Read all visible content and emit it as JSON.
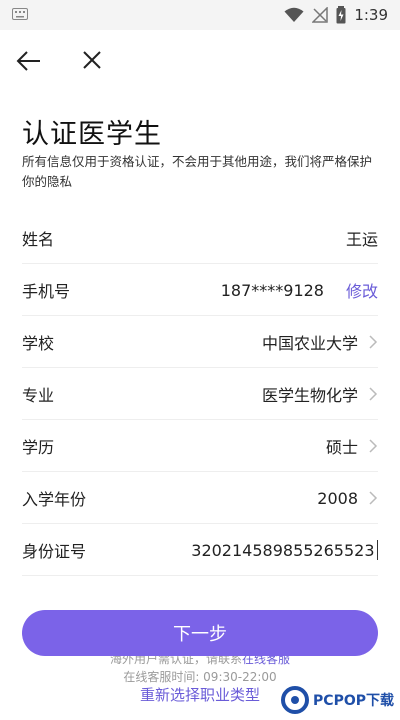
{
  "status_bar": {
    "time": "1:39"
  },
  "page": {
    "title": "认证医学生",
    "description": "所有信息仅用于资格认证，不会用于其他用途，我们将严格保护你的隐私"
  },
  "form": {
    "rows": [
      {
        "label": "姓名",
        "value": "王运"
      },
      {
        "label": "手机号",
        "value": "187****9128",
        "action": "修改"
      },
      {
        "label": "学校",
        "value": "中国农业大学"
      },
      {
        "label": "专业",
        "value": "医学生物化学"
      },
      {
        "label": "学历",
        "value": "硕士"
      },
      {
        "label": "入学年份",
        "value": "2008"
      },
      {
        "label": "身份证号",
        "value": "320214589855265523"
      }
    ]
  },
  "footer": {
    "next_label": "下一步",
    "notice_prefix": "海外用户需认证，请联系",
    "notice_link": "在线客服",
    "hours": "在线客服时间: 09:30-22:00",
    "reselect": "重新选择职业类型"
  },
  "watermark": {
    "text": "PCPOP下载"
  },
  "colors": {
    "accent": "#6a5cd8",
    "button": "#7b63e8"
  }
}
